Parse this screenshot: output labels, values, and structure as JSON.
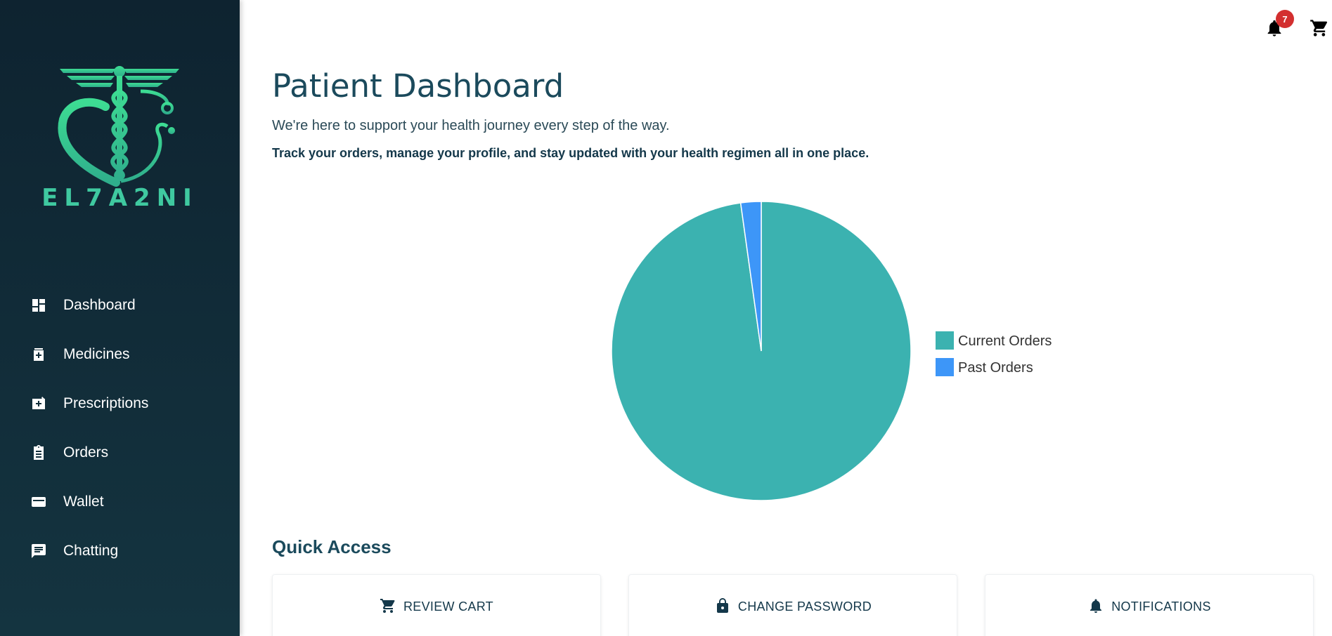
{
  "brand": {
    "name": "EL7A2NI"
  },
  "sidebar": {
    "items": [
      {
        "label": "Dashboard",
        "icon": "dashboard-icon"
      },
      {
        "label": "Medicines",
        "icon": "medicine-icon"
      },
      {
        "label": "Prescriptions",
        "icon": "prescription-icon"
      },
      {
        "label": "Orders",
        "icon": "clipboard-icon"
      },
      {
        "label": "Wallet",
        "icon": "wallet-icon"
      },
      {
        "label": "Chatting",
        "icon": "chat-icon"
      }
    ]
  },
  "topbar": {
    "notification_count": "7",
    "icons": [
      "bell-icon",
      "cart-icon",
      "account-icon"
    ]
  },
  "header": {
    "title": "Patient Dashboard",
    "subtitle": "We're here to support your health journey every step of the way.",
    "subtitle2": "Track your orders, manage your profile, and stay updated with your health regimen all in one place."
  },
  "chart_data": {
    "type": "pie",
    "categories": [
      "Current Orders",
      "Past Orders"
    ],
    "values": [
      97.8,
      2.2
    ],
    "colors": [
      "#3bb2b0",
      "#3d96f8"
    ],
    "legend": "right"
  },
  "quick_access": {
    "title": "Quick Access",
    "cards": [
      {
        "label": "REVIEW CART",
        "icon": "cart-icon"
      },
      {
        "label": "CHANGE PASSWORD",
        "icon": "lock-icon"
      },
      {
        "label": "NOTIFICATIONS",
        "icon": "bell-icon"
      }
    ]
  },
  "colors": {
    "sidebar_bg": "#0e2330",
    "brand": "#3fc9a0",
    "title": "#1b4a5c",
    "badge": "#d32f2f"
  }
}
